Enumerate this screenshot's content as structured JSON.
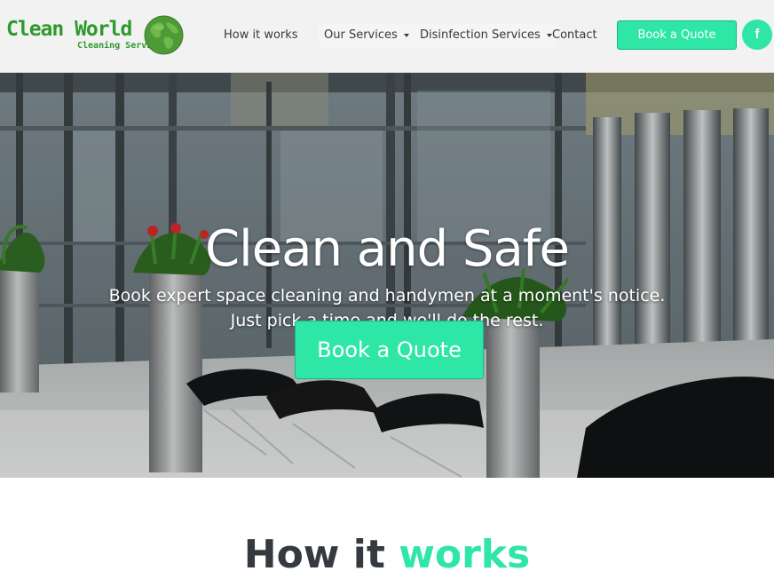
{
  "brand": {
    "name": "Clean World",
    "tagline": "Cleaning Service",
    "color": "#2e9a2e"
  },
  "nav": {
    "items": [
      {
        "label": "How it works",
        "has_dropdown": false
      },
      {
        "label": "Our Services",
        "has_dropdown": true
      },
      {
        "label": "Disinfection Services",
        "has_dropdown": true
      },
      {
        "label": "Contact",
        "has_dropdown": false
      }
    ],
    "cta_label": "Book a Quote",
    "social_icon": "facebook-icon",
    "social_glyph": "f"
  },
  "hero": {
    "title": "Clean and Safe",
    "line1": "Book expert space cleaning and handymen at a moment's notice.",
    "line2": "Just pick a time and we'll do the rest.",
    "cta_label": "Book a Quote",
    "background": "office-lobby-photo"
  },
  "how_it_works": {
    "title_part1": "How it ",
    "title_part2": "works"
  },
  "colors": {
    "accent": "#2ee6a6",
    "header_bg": "#f2f2f2",
    "text_dark": "#343a40"
  }
}
